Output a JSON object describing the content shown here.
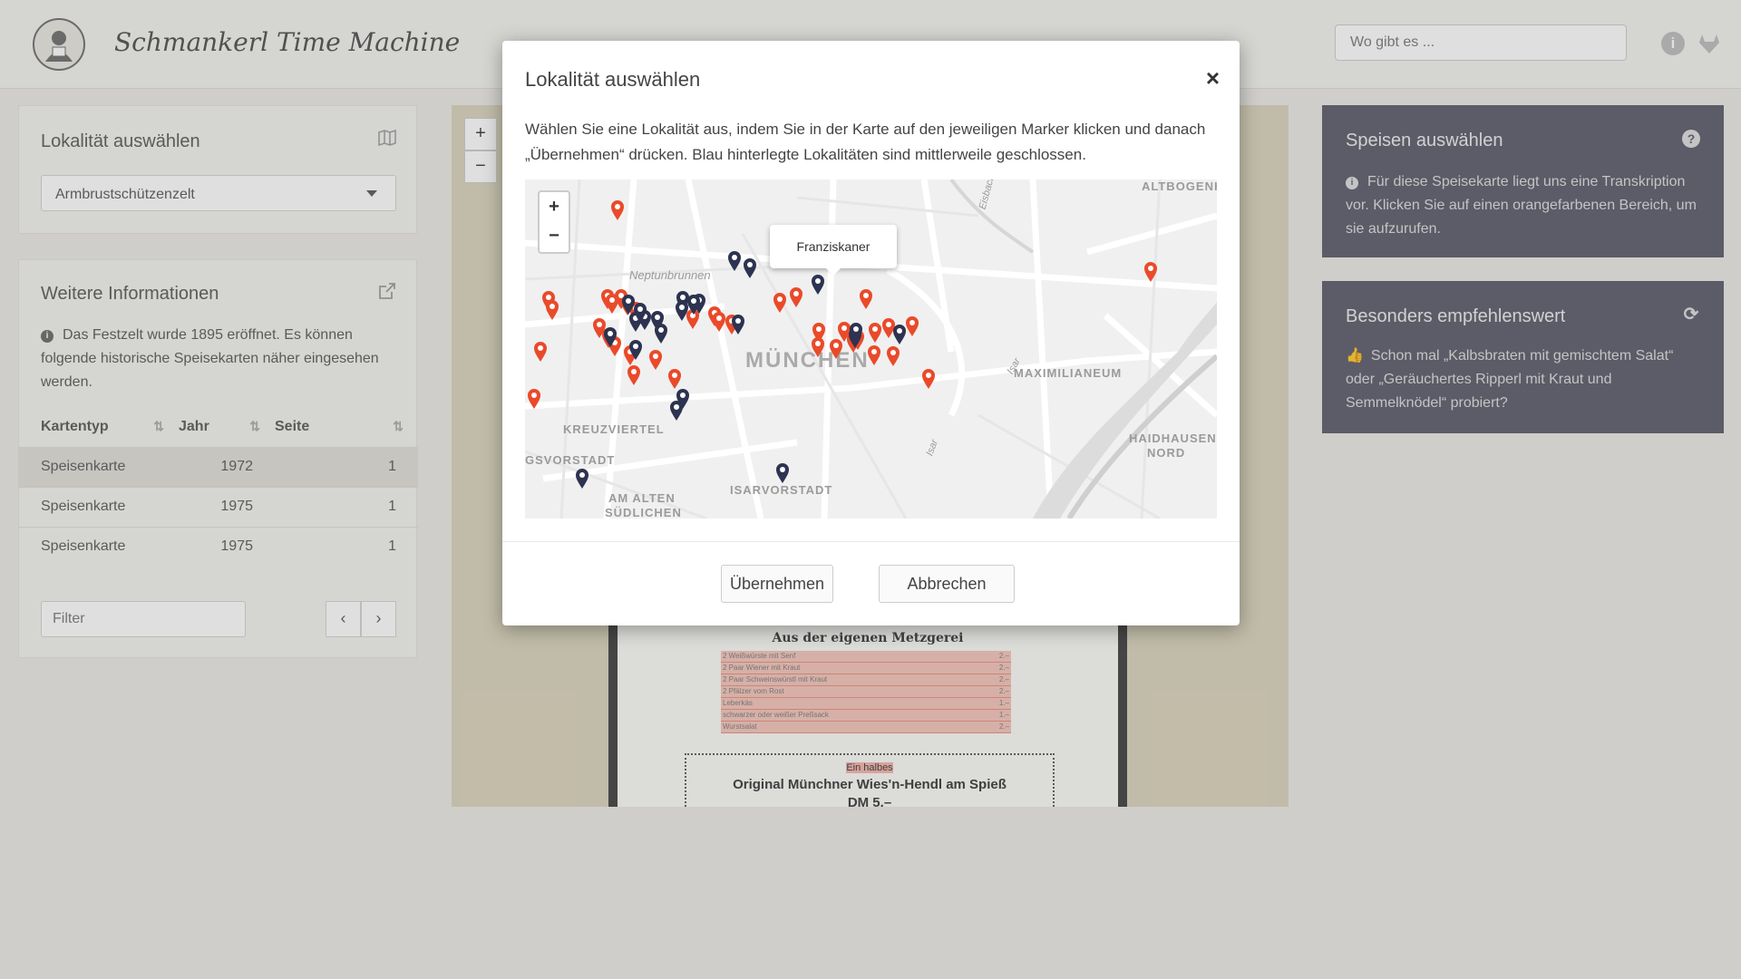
{
  "header": {
    "title": "Schmankerl Time Machine",
    "search_placeholder": "Wo gibt es ...",
    "info_icon": "info-icon",
    "gitlab_icon": "gitlab-icon"
  },
  "location_panel": {
    "title": "Lokalität auswählen",
    "selected": "Armbrustschützenzelt",
    "icon": "map-icon"
  },
  "info_panel": {
    "title": "Weitere Informationen",
    "text": "Das Festzelt wurde 1895 eröffnet. Es können folgende historische Speisekarten näher eingesehen werden.",
    "table": {
      "headers": [
        "Kartentyp",
        "Jahr",
        "Seite"
      ],
      "rows": [
        [
          "Speisenkarte",
          "1972",
          "1"
        ],
        [
          "Speisenkarte",
          "1975",
          "1"
        ],
        [
          "Speisenkarte",
          "1975",
          "1"
        ]
      ]
    },
    "filter_placeholder": "Filter",
    "prev": "‹",
    "next": "›"
  },
  "viewer": {
    "zoom_in": "+",
    "zoom_out": "−",
    "menu_heading": "Aus der eigenen Metzgerei",
    "menu_items": [
      "2 Weißwürste mit Senf",
      "2 Paar Wiener mit Kraut",
      "2 Paar Schweinswürstl mit Kraut",
      "2 Pfälzer vom Rost",
      "Leberkäs",
      "schwarzer oder weißer Preßsack",
      "Wurstsalat"
    ],
    "menu_prices": [
      "2.–",
      "2.–",
      "2.–",
      "2.–",
      "1.–",
      "1.–",
      "2.–"
    ],
    "hendl_small": "Ein halbes",
    "hendl_title": "Original Münchner Wies'n-Hendl am Spieß",
    "hendl_price": "DM 5.–"
  },
  "dishes_panel": {
    "title": "Speisen auswählen",
    "text": "Für diese Speisekarte liegt uns eine Transkription vor. Klicken Sie auf einen orangefarbenen Bereich, um sie aufzurufen."
  },
  "recommend_panel": {
    "title": "Besonders empfehlenswert",
    "text": "Schon mal „Kalbsbraten mit gemischtem Salat“ oder „Geräuchertes Ripperl mit Kraut und Semmelknödel“ probiert?"
  },
  "modal": {
    "title": "Lokalität auswählen",
    "close": "×",
    "text": "Wählen Sie eine Lokalität aus, indem Sie in der Karte auf den jeweiligen Marker klicken und danach „Übernehmen“ drücken. Blau hinterlegte Lokalitäten sind mittlerweile geschlossen.",
    "tooltip": "Franziskaner",
    "zoom_in": "+",
    "zoom_out": "−",
    "accept": "Übernehmen",
    "cancel": "Abbrechen",
    "map_labels": [
      "ALTBOGENHAUSEN",
      "Neptunbrunnen",
      "MÜNCHEN",
      "MAXIMILIANEUM",
      "KREUZVIERTEL",
      "GSVORSTADT",
      "HAIDHAUSEN-",
      "NORD",
      "AM ALTEN",
      "SÜDLICHEN",
      "ISARVORSTADT",
      "Isar",
      "Isar",
      "Eisbach"
    ]
  },
  "colors": {
    "open_marker": "#ea4a2a",
    "closed_marker": "#2d3350",
    "dark_panel": "#565866"
  }
}
